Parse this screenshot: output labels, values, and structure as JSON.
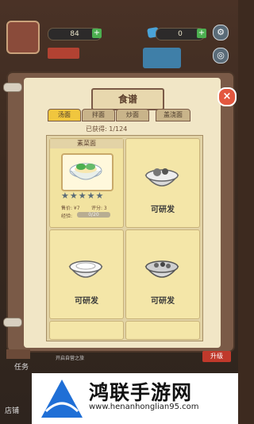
{
  "hud": {
    "coins": "84",
    "gems": "0"
  },
  "recipe_book": {
    "title": "食谱",
    "close_label": "×",
    "tabs": [
      {
        "label": "汤面",
        "active": true
      },
      {
        "label": "拌面",
        "active": false
      },
      {
        "label": "炒面",
        "active": false
      },
      {
        "label": "盖浇面",
        "active": false
      }
    ],
    "collected": "已获得: 1/124",
    "cards": [
      {
        "name": "素菜面",
        "price": "售价: ¥7",
        "score": "评分: 3",
        "progress_label": "经验:",
        "progress_text": "0/20",
        "progress": 0.0,
        "stars": 5
      },
      {
        "status": "可研发"
      },
      {
        "status": "可研发"
      },
      {
        "status": "可研发"
      }
    ]
  },
  "background": {
    "task_label": "任务",
    "store_label": "店铺",
    "top_promo": "升级",
    "sign": "开启自营之旅"
  },
  "watermark": {
    "brand": "鸿联手游网",
    "url": "www.henanhonglian95.com"
  },
  "colors": {
    "accent": "#f0c63e",
    "close": "#e3573f",
    "book": "#7a5a47",
    "page": "#f1e6c6"
  }
}
